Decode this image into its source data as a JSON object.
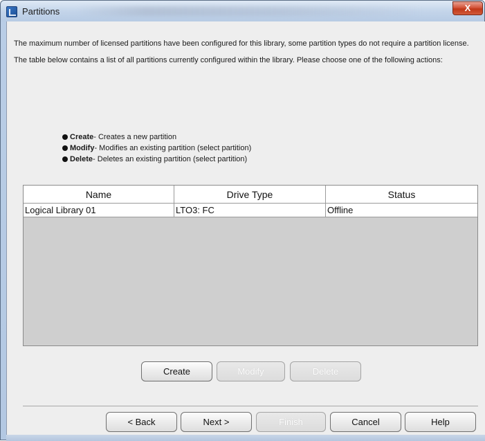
{
  "window": {
    "title": "Partitions",
    "close_label": "X"
  },
  "intro": {
    "para1": "The maximum number of licensed partitions have been configured for this library, some partition types do not require a partition license.",
    "para2": "The table below contains a list of all partitions currently configured within the library. Please choose one of the following actions:"
  },
  "actions_list": [
    {
      "name": "Create",
      "desc": " - Creates a new partition"
    },
    {
      "name": "Modify",
      "desc": " - Modifies an existing partition (select partition)"
    },
    {
      "name": "Delete",
      "desc": " - Deletes an existing partition (select partition)"
    }
  ],
  "table": {
    "columns": [
      "Name",
      "Drive Type",
      "Status"
    ],
    "rows": [
      [
        "Logical Library 01",
        "LTO3: FC",
        "Offline"
      ]
    ]
  },
  "partition_buttons": {
    "create": "Create",
    "modify": "Modify",
    "delete": "Delete"
  },
  "nav_buttons": {
    "back": "< Back",
    "next": "Next >",
    "finish": "Finish",
    "cancel": "Cancel",
    "help": "Help"
  }
}
